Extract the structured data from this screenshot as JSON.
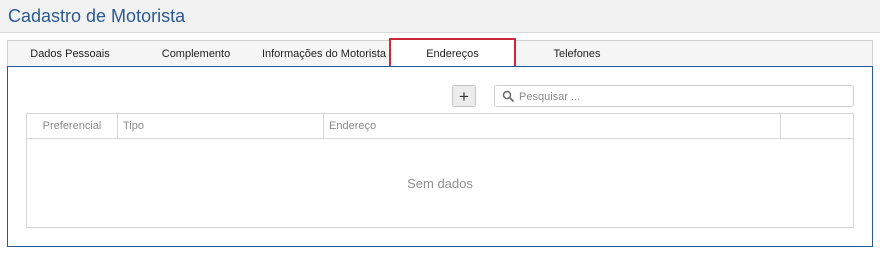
{
  "page": {
    "title": "Cadastro de Motorista"
  },
  "tabs": [
    {
      "label": "Dados Pessoais",
      "active": false
    },
    {
      "label": "Complemento",
      "active": false
    },
    {
      "label": "Informações do Motorista",
      "active": false
    },
    {
      "label": "Endereços",
      "active": true
    },
    {
      "label": "Telefones",
      "active": false
    }
  ],
  "toolbar": {
    "add_label": "+",
    "search_placeholder": "Pesquisar ..."
  },
  "grid": {
    "columns": [
      "Preferencial",
      "Tipo",
      "Endereço",
      ""
    ],
    "empty_text": "Sem dados"
  },
  "colors": {
    "title": "#2a5a91",
    "panel_border": "#2a5a91",
    "active_tab_border": "#c8283a"
  }
}
